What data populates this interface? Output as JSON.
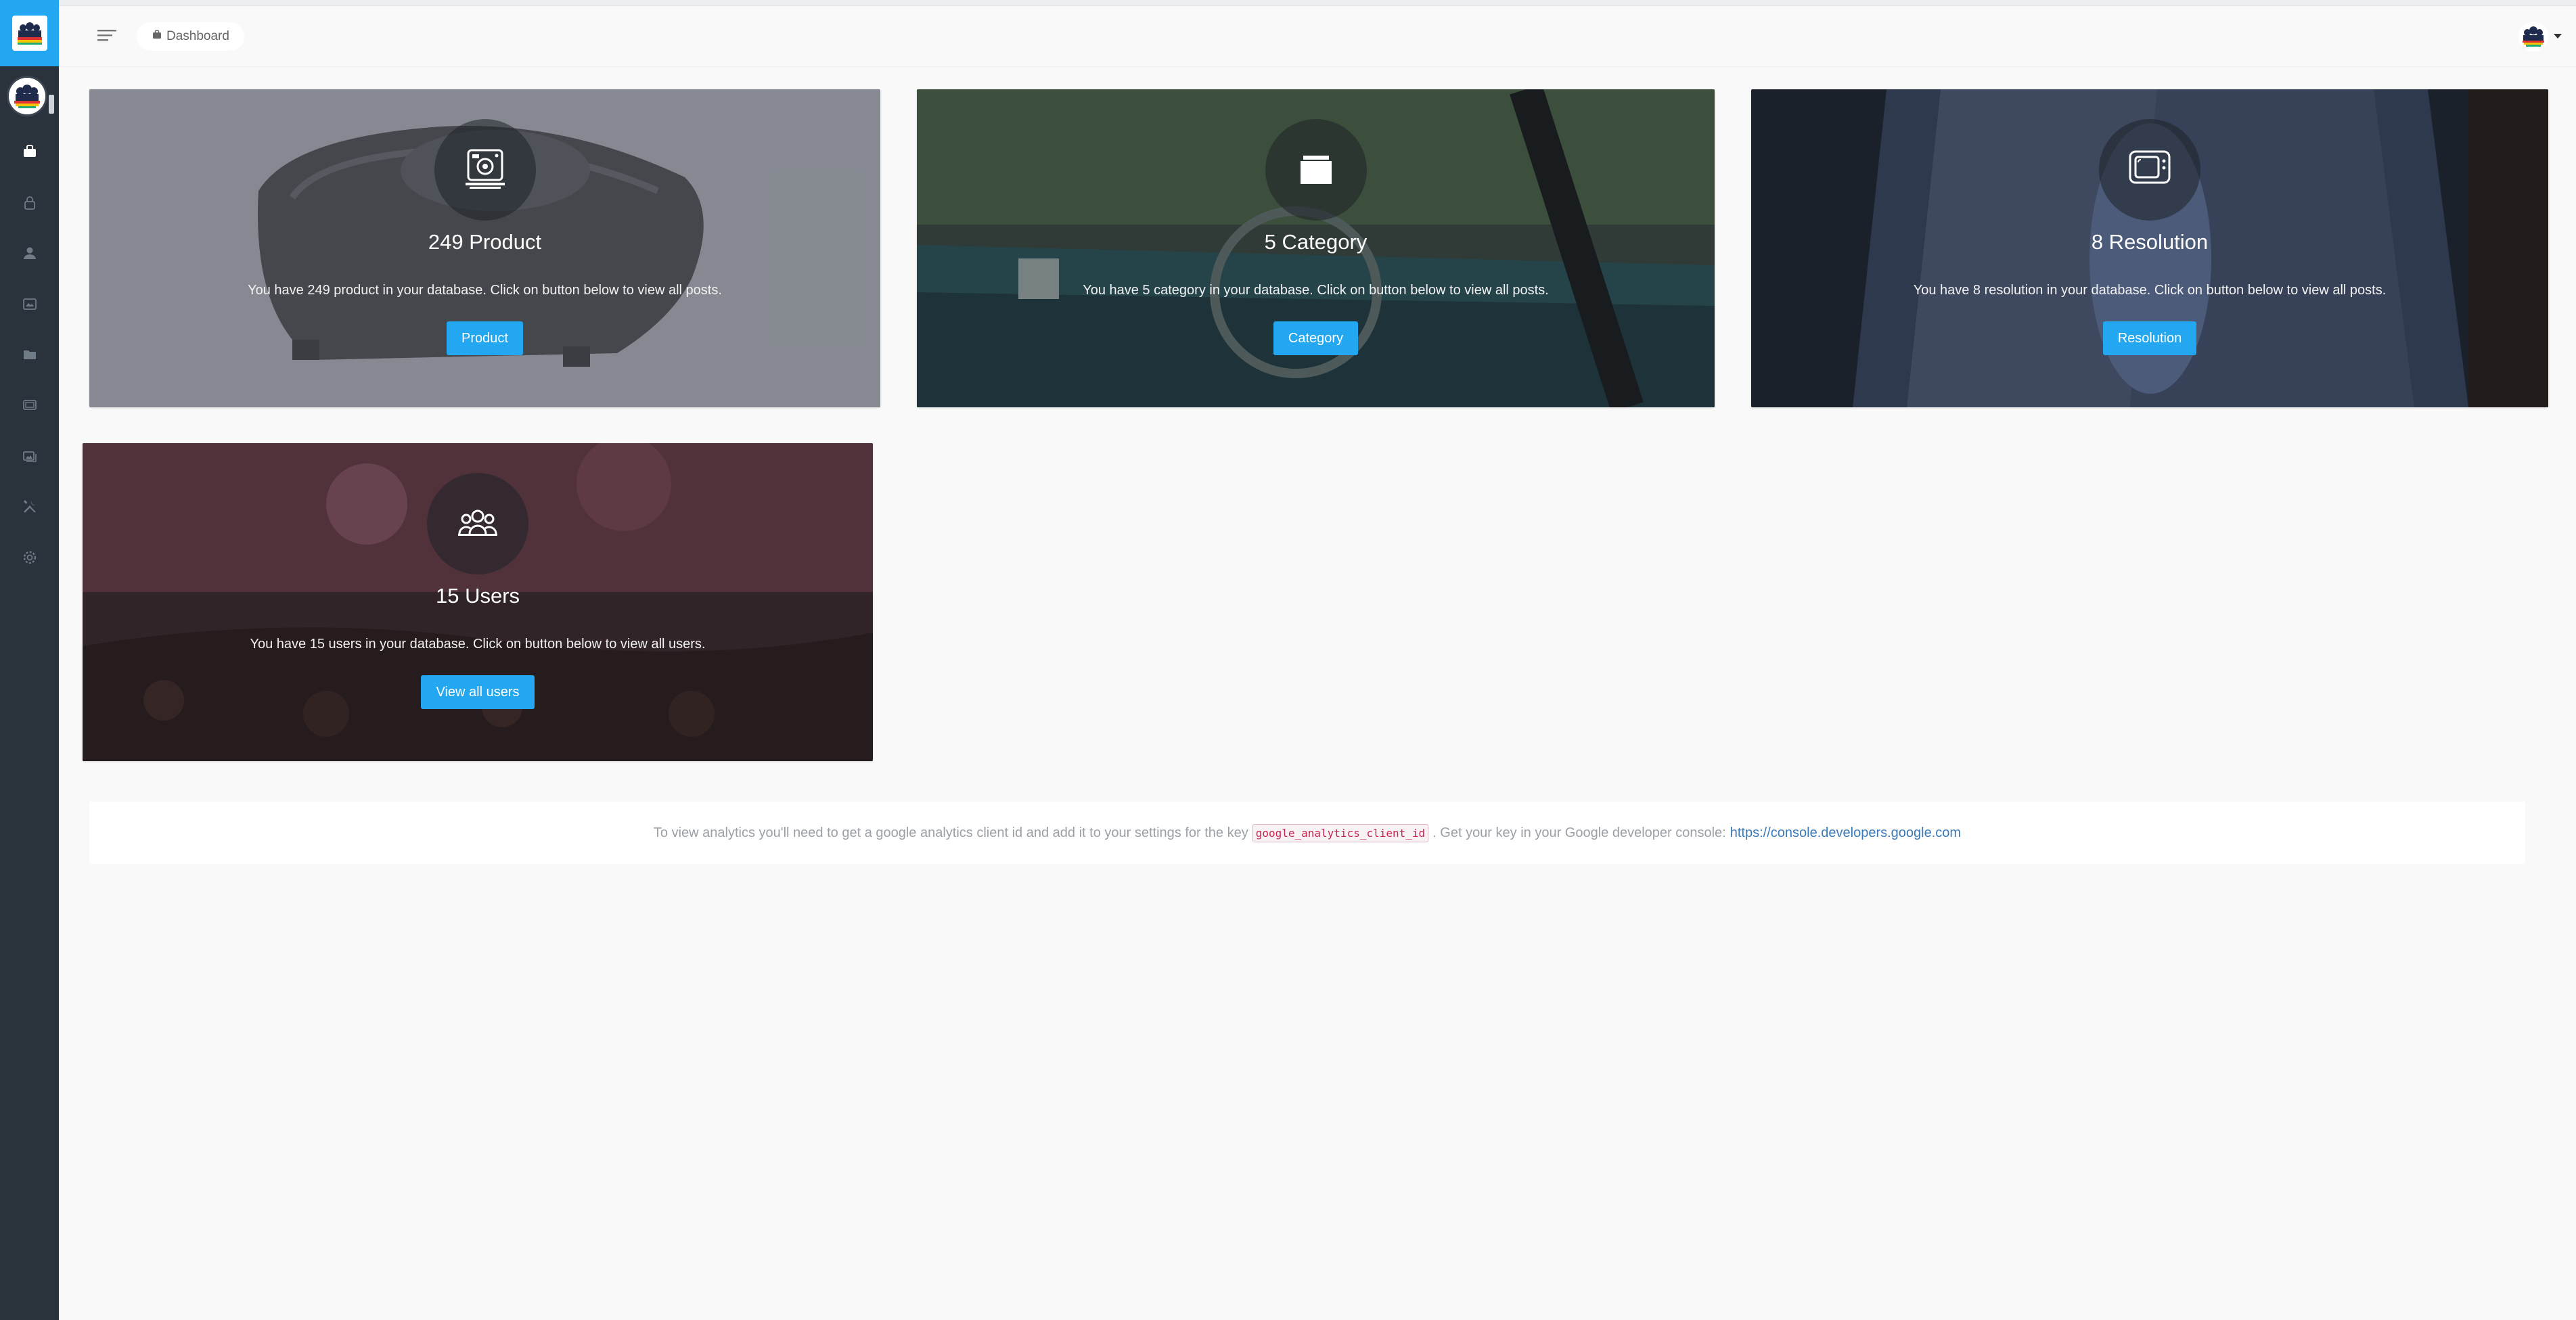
{
  "header": {
    "breadcrumb": "Dashboard"
  },
  "sidebar": {
    "items": [
      {
        "icon": "dashboard-bag-icon"
      },
      {
        "icon": "lock-icon"
      },
      {
        "icon": "user-icon"
      },
      {
        "icon": "media-icon"
      },
      {
        "icon": "folder-icon"
      },
      {
        "icon": "tv-icon"
      },
      {
        "icon": "gallery-icon"
      },
      {
        "icon": "tools-icon"
      },
      {
        "icon": "settings-icon"
      }
    ]
  },
  "cards": [
    {
      "title": "249 Product",
      "description": "You have 249 product in your database. Click on button below to view all posts.",
      "button": "Product",
      "icon": "camera-icon"
    },
    {
      "title": "5 Category",
      "description": "You have 5 category in your database. Click on button below to view all posts.",
      "button": "Category",
      "icon": "folder-icon"
    },
    {
      "title": "8 Resolution",
      "description": "You have 8 resolution in your database. Click on button below to view all posts.",
      "button": "Resolution",
      "icon": "tv-icon"
    },
    {
      "title": "15 Users",
      "description": "You have 15 users in your database. Click on button below to view all users.",
      "button": "View all users",
      "icon": "users-icon"
    }
  ],
  "analytics": {
    "text_before": "To view analytics you'll need to get a google analytics client id and add it to your settings for the key",
    "key": "google_analytics_client_id",
    "text_after": ". Get your key in your Google developer console:",
    "link": "https://console.developers.google.com"
  },
  "colors": {
    "accent": "#22a7f0",
    "sidebar": "#2a323c"
  }
}
